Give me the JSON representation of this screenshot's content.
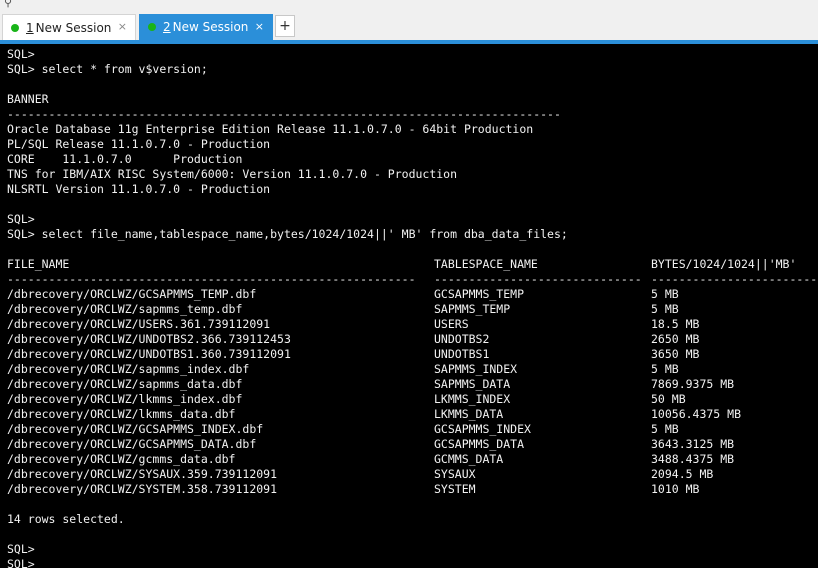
{
  "tabs": [
    {
      "number": "1",
      "label": "New Session",
      "close": "×"
    },
    {
      "number": "2",
      "label": "New Session",
      "close": "×"
    }
  ],
  "new_tab_label": "+",
  "top_icon": "pin-icon",
  "colors": {
    "accent": "#2b8fd9",
    "status_dot": "#19b419",
    "terminal_bg": "#000000",
    "terminal_fg": "#f2f2f2"
  },
  "terminal": {
    "prompt1": "SQL>",
    "cmd1": "SQL> select * from v$version;",
    "banner_header": "BANNER",
    "banner_rule": "--------------------------------------------------------------------------------",
    "banner_rows": [
      "Oracle Database 11g Enterprise Edition Release 11.1.0.7.0 - 64bit Production",
      "PL/SQL Release 11.1.0.7.0 - Production",
      "CORE    11.1.0.7.0      Production",
      "TNS for IBM/AIX RISC System/6000: Version 11.1.0.7.0 - Production",
      "NLSRTL Version 11.1.0.7.0 - Production"
    ],
    "prompt2": "SQL>",
    "cmd2": "SQL> select file_name,tablespace_name,bytes/1024/1024||' MB' from dba_data_files;",
    "columns": [
      "FILE_NAME",
      "TABLESPACE_NAME",
      "BYTES/1024/1024||'MB'"
    ],
    "rules": [
      "-----------------------------------------------------------",
      "------------------------------",
      "----------------------------"
    ],
    "rows": [
      [
        "/dbrecovery/ORCLWZ/GCSAPMMS_TEMP.dbf",
        "GCSAPMMS_TEMP",
        "5 MB"
      ],
      [
        "/dbrecovery/ORCLWZ/sapmms_temp.dbf",
        "SAPMMS_TEMP",
        "5 MB"
      ],
      [
        "/dbrecovery/ORCLWZ/USERS.361.739112091",
        "USERS",
        "18.5 MB"
      ],
      [
        "/dbrecovery/ORCLWZ/UNDOTBS2.366.739112453",
        "UNDOTBS2",
        "2650 MB"
      ],
      [
        "/dbrecovery/ORCLWZ/UNDOTBS1.360.739112091",
        "UNDOTBS1",
        "3650 MB"
      ],
      [
        "/dbrecovery/ORCLWZ/sapmms_index.dbf",
        "SAPMMS_INDEX",
        "5 MB"
      ],
      [
        "/dbrecovery/ORCLWZ/sapmms_data.dbf",
        "SAPMMS_DATA",
        "7869.9375 MB"
      ],
      [
        "/dbrecovery/ORCLWZ/lkmms_index.dbf",
        "LKMMS_INDEX",
        "50 MB"
      ],
      [
        "/dbrecovery/ORCLWZ/lkmms_data.dbf",
        "LKMMS_DATA",
        "10056.4375 MB"
      ],
      [
        "/dbrecovery/ORCLWZ/GCSAPMMS_INDEX.dbf",
        "GCSAPMMS_INDEX",
        "5 MB"
      ],
      [
        "/dbrecovery/ORCLWZ/GCSAPMMS_DATA.dbf",
        "GCSAPMMS_DATA",
        "3643.3125 MB"
      ],
      [
        "/dbrecovery/ORCLWZ/gcmms_data.dbf",
        "GCMMS_DATA",
        "3488.4375 MB"
      ],
      [
        "/dbrecovery/ORCLWZ/SYSAUX.359.739112091",
        "SYSAUX",
        "2094.5 MB"
      ],
      [
        "/dbrecovery/ORCLWZ/SYSTEM.358.739112091",
        "SYSTEM",
        "1010 MB"
      ]
    ],
    "summary": "14 rows selected.",
    "prompt3": "SQL>",
    "prompt4": "SQL>"
  }
}
